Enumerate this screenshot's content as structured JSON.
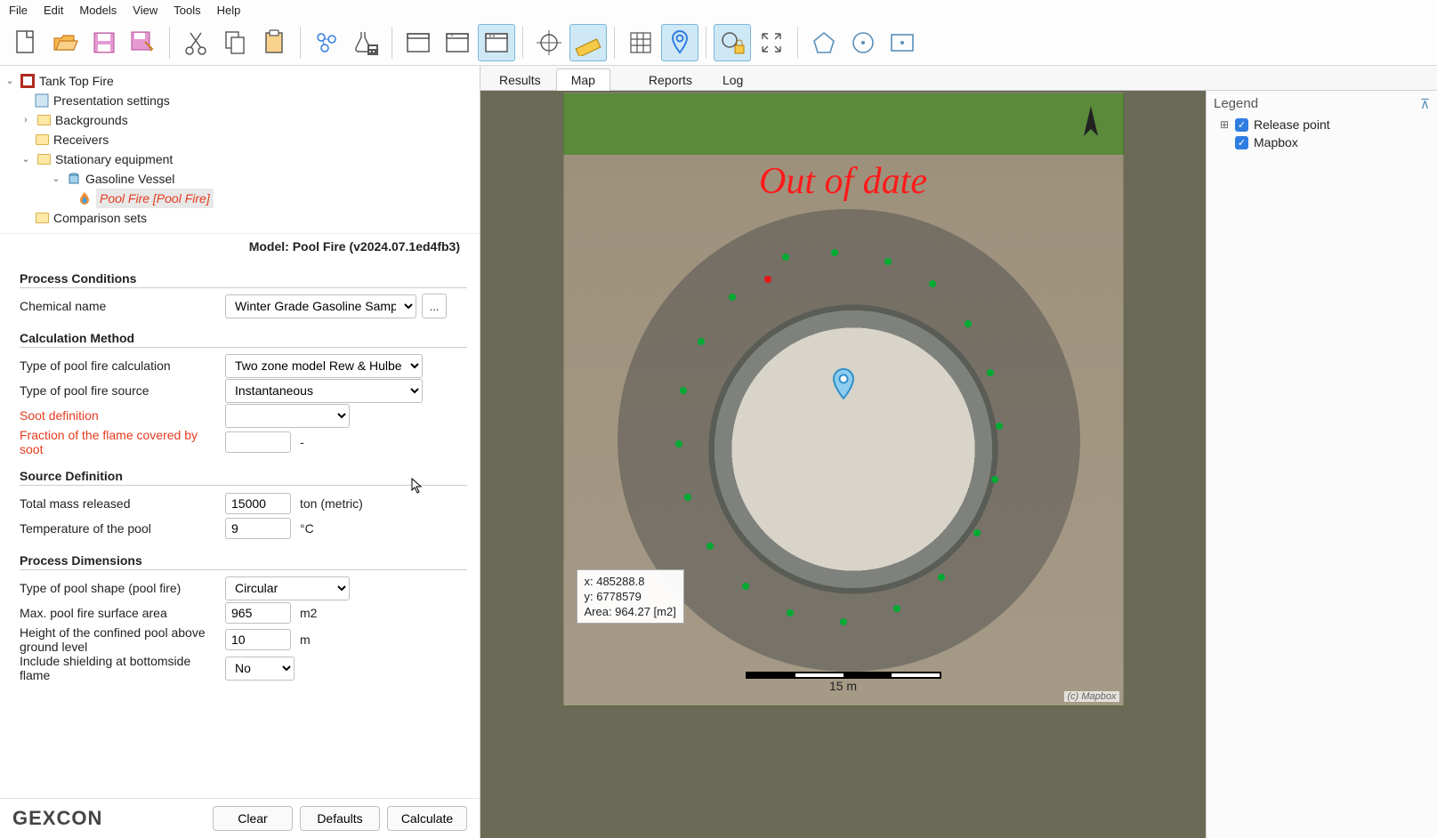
{
  "menu": {
    "file": "File",
    "edit": "Edit",
    "models": "Models",
    "view": "View",
    "tools": "Tools",
    "help": "Help"
  },
  "tree": {
    "root": "Tank Top Fire",
    "presentation": "Presentation settings",
    "backgrounds": "Backgrounds",
    "receivers": "Receivers",
    "stationary": "Stationary equipment",
    "vessel": "Gasoline Vessel",
    "poolfire": "Pool Fire [Pool Fire]",
    "comparison": "Comparison sets"
  },
  "model_label": "Model: Pool Fire (v2024.07.1ed4fb3)",
  "sections": {
    "process_conditions": "Process Conditions",
    "calc_method": "Calculation Method",
    "source_def": "Source Definition",
    "process_dims": "Process Dimensions"
  },
  "form": {
    "chemical": {
      "label": "Chemical name",
      "value": "Winter Grade Gasoline Sample"
    },
    "calc_type": {
      "label": "Type of pool fire calculation",
      "value": "Two zone model Rew & Hulbert"
    },
    "source_type": {
      "label": "Type of pool fire source",
      "value": "Instantaneous"
    },
    "soot": {
      "label": "Soot definition",
      "value": ""
    },
    "soot_fraction": {
      "label": "Fraction of the flame covered by soot",
      "value": "",
      "unit": "-"
    },
    "mass": {
      "label": "Total mass released",
      "value": "15000",
      "unit": "ton (metric)"
    },
    "temp": {
      "label": "Temperature of the pool",
      "value": "9",
      "unit": "°C"
    },
    "shape": {
      "label": "Type of pool shape (pool fire)",
      "value": "Circular"
    },
    "area": {
      "label": "Max. pool fire surface area",
      "value": "965",
      "unit": "m2"
    },
    "height": {
      "label": "Height of the confined pool above ground level",
      "value": "10",
      "unit": "m"
    },
    "shield": {
      "label": "Include shielding at bottomside flame",
      "value": "No"
    }
  },
  "footer": {
    "logo": "GEXCON",
    "clear": "Clear",
    "defaults": "Defaults",
    "calculate": "Calculate"
  },
  "tabs": {
    "results": "Results",
    "map": "Map",
    "reports": "Reports",
    "log": "Log"
  },
  "map": {
    "stamp": "Out of date",
    "coords": {
      "x": "x: 485288.8",
      "y": "y: 6778579",
      "area": "Area: 964.27 [m2]"
    },
    "scale": "15 m",
    "attrib": "(c) Mapbox"
  },
  "legend": {
    "title": "Legend",
    "release": "Release point",
    "mapbox": "Mapbox"
  }
}
